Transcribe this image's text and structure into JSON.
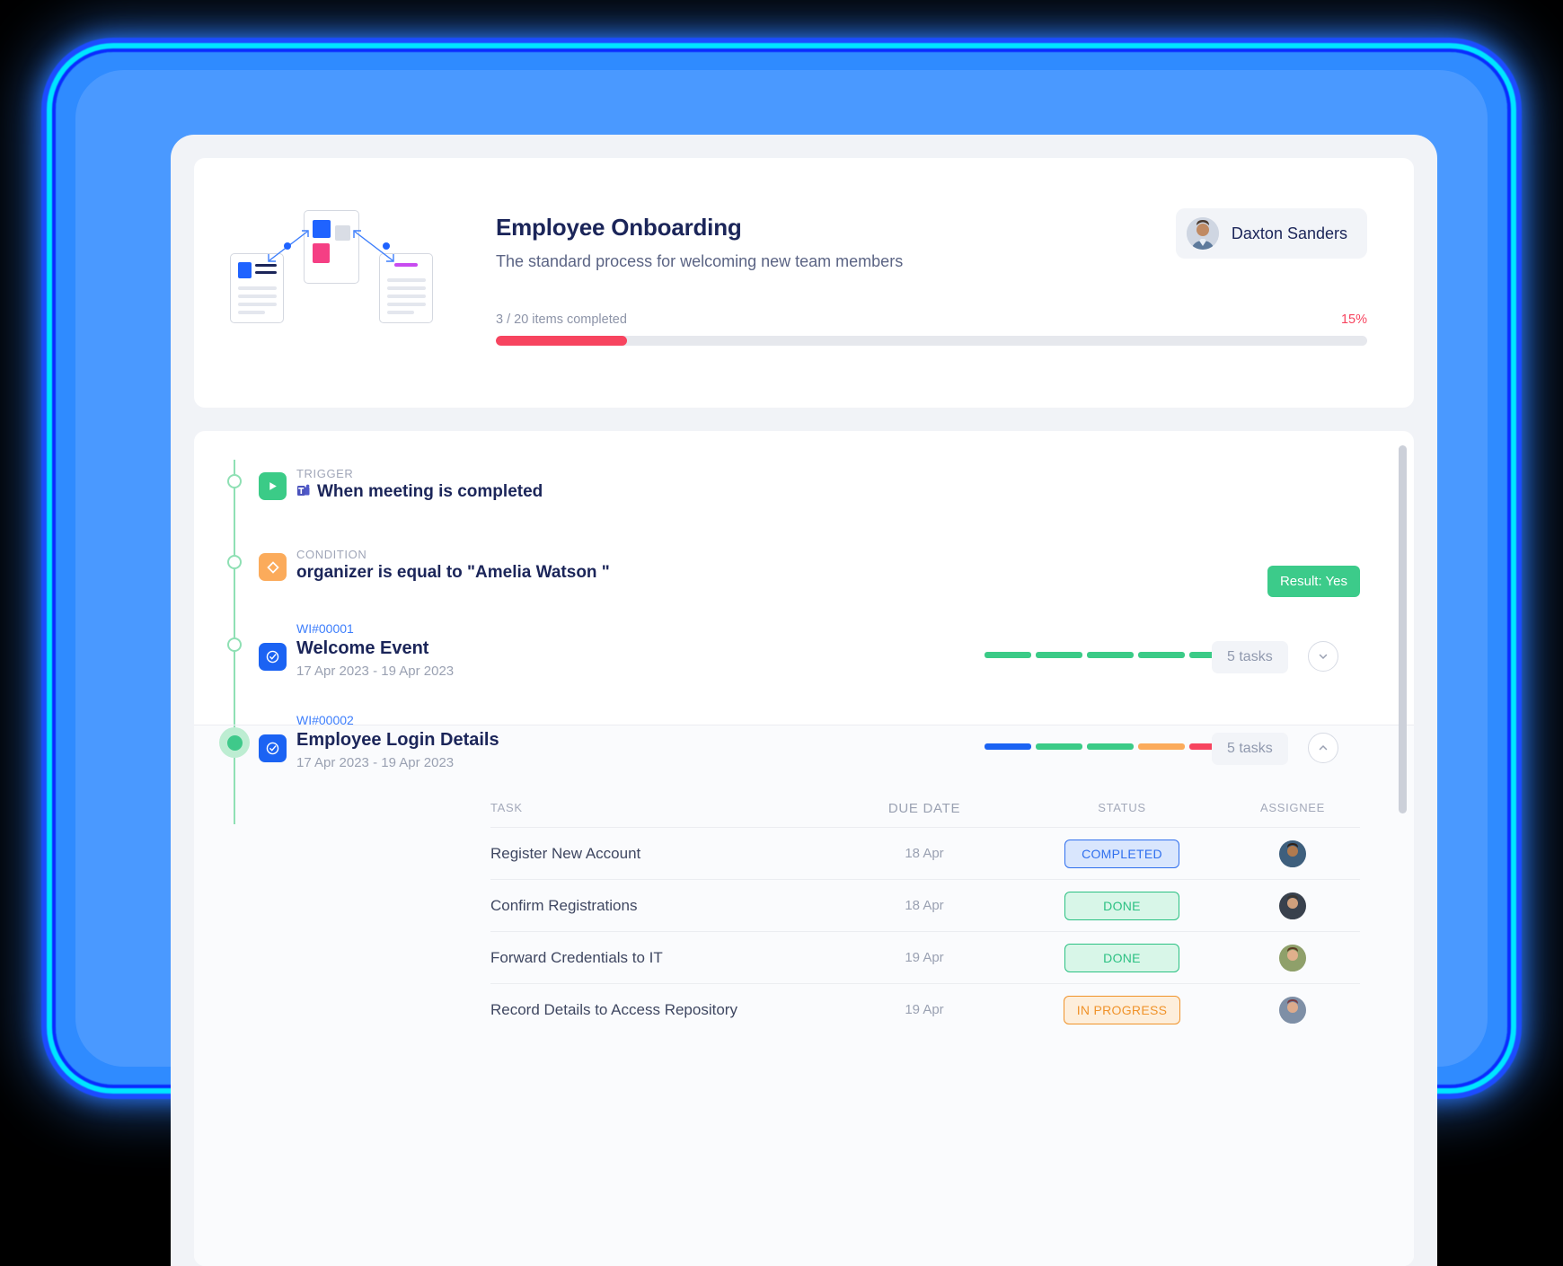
{
  "header": {
    "title": "Employee Onboarding",
    "subtitle": "The standard process for welcoming new team members",
    "progress_label": "3 / 20 items completed",
    "progress_pct_label": "15%",
    "progress_pct": 15,
    "completed_items": 3,
    "total_items": 20,
    "accent_color": "#f7445f",
    "user": {
      "name": "Daxton Sanders",
      "avatar_icon": "user-avatar"
    }
  },
  "flow": {
    "trigger": {
      "kicker": "TRIGGER",
      "title": "When meeting is completed",
      "icon": "play-icon",
      "app_icon": "microsoft-teams-icon",
      "icon_color": "#3bcb87"
    },
    "condition": {
      "kicker": "CONDITION",
      "title": "organizer is equal to \"Amelia Watson \"",
      "icon": "diamond-icon",
      "icon_color": "#fbab5b",
      "result_badge": "Result: Yes",
      "result_color": "#3ccb8a"
    },
    "work_items": [
      {
        "id": "WI#00001",
        "name": "Welcome Event",
        "dates": "17 Apr 2023 - 19 Apr 2023",
        "task_count_label": "5 tasks",
        "expanded": false,
        "chevron_icon": "chevron-down-icon",
        "icon": "target-check-icon",
        "segments": [
          "#3bcb87",
          "#3bcb87",
          "#3bcb87",
          "#3bcb87",
          "#3bcb87"
        ]
      },
      {
        "id": "WI#00002",
        "name": "Employee Login Details",
        "dates": "17 Apr 2023 - 19 Apr 2023",
        "task_count_label": "5 tasks",
        "expanded": true,
        "chevron_icon": "chevron-up-icon",
        "icon": "target-check-icon",
        "segments": [
          "#1b63f3",
          "#3bcb87",
          "#3bcb87",
          "#fbab5b",
          "#f7445f"
        ]
      }
    ]
  },
  "task_table": {
    "columns": [
      "TASK",
      "DUE DATE",
      "STATUS",
      "ASSIGNEE"
    ],
    "rows": [
      {
        "task": "Register New Account",
        "due": "18 Apr",
        "status": "COMPLETED",
        "status_kind": "completed",
        "assignee_icon": "avatar-man-1"
      },
      {
        "task": "Confirm Registrations",
        "due": "18 Apr",
        "status": "DONE",
        "status_kind": "done",
        "assignee_icon": "avatar-man-2"
      },
      {
        "task": "Forward Credentials to IT",
        "due": "19 Apr",
        "status": "DONE",
        "status_kind": "done",
        "assignee_icon": "avatar-woman-1"
      },
      {
        "task": "Record Details to Access Repository",
        "due": "19 Apr",
        "status": "IN PROGRESS",
        "status_kind": "progress",
        "assignee_icon": "avatar-woman-2"
      }
    ]
  }
}
